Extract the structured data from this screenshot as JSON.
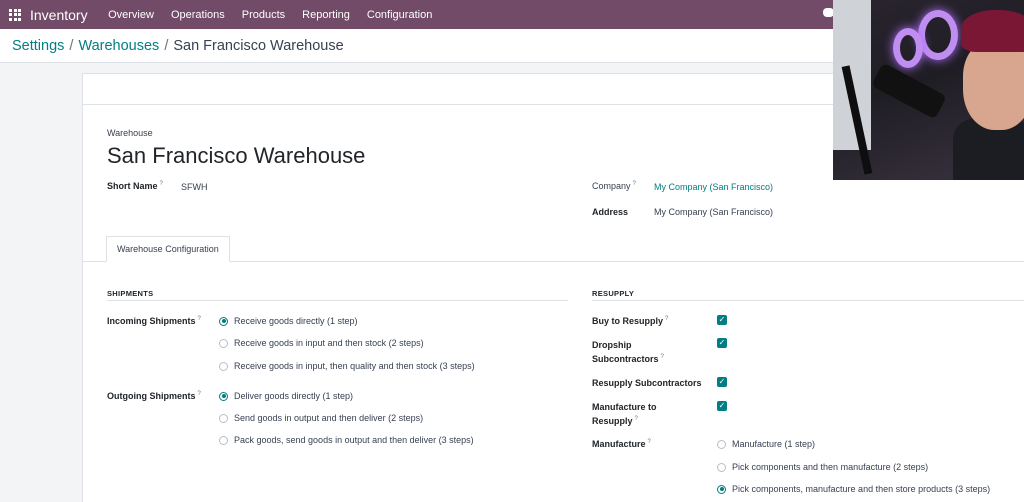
{
  "navbar": {
    "app_name": "Inventory",
    "menu": [
      "Overview",
      "Operations",
      "Products",
      "Reporting",
      "Configuration"
    ],
    "bg_color": "#714b67"
  },
  "breadcrumb": {
    "items": [
      "Settings",
      "Warehouses"
    ],
    "current": "San Francisco Warehouse",
    "separator": "/"
  },
  "form": {
    "overline": "Warehouse",
    "title": "San Francisco Warehouse",
    "short_name_label": "Short Name",
    "short_name_value": "SFWH",
    "company_label": "Company",
    "company_value": "My Company (San Francisco)",
    "address_label": "Address",
    "address_value": "My Company (San Francisco)",
    "help_mark": "?"
  },
  "tabs": {
    "active": "Warehouse Configuration"
  },
  "shipments": {
    "title": "SHIPMENTS",
    "incoming_label": "Incoming Shipments",
    "incoming_options": [
      "Receive goods directly (1 step)",
      "Receive goods in input and then stock (2 steps)",
      "Receive goods in input, then quality and then stock (3 steps)"
    ],
    "incoming_selected": 0,
    "outgoing_label": "Outgoing Shipments",
    "outgoing_options": [
      "Deliver goods directly (1 step)",
      "Send goods in output and then deliver (2 steps)",
      "Pack goods, send goods in output and then deliver (3 steps)"
    ],
    "outgoing_selected": 0
  },
  "resupply": {
    "title": "RESUPPLY",
    "buy_label": "Buy to Resupply",
    "buy_checked": true,
    "dropship_label_1": "Dropship",
    "dropship_label_2": "Subcontractors",
    "dropship_checked": true,
    "resupply_sub_label": "Resupply Subcontractors",
    "resupply_sub_checked": true,
    "manufacture_to_label_1": "Manufacture to",
    "manufacture_to_label_2": "Resupply",
    "manufacture_to_checked": true,
    "manufacture_label": "Manufacture",
    "manufacture_options": [
      "Manufacture (1 step)",
      "Pick components and then manufacture (2 steps)",
      "Pick components, manufacture and then store products (3 steps)"
    ],
    "manufacture_selected": 2
  },
  "colors": {
    "accent": "#017e84",
    "link": "#017e84"
  }
}
